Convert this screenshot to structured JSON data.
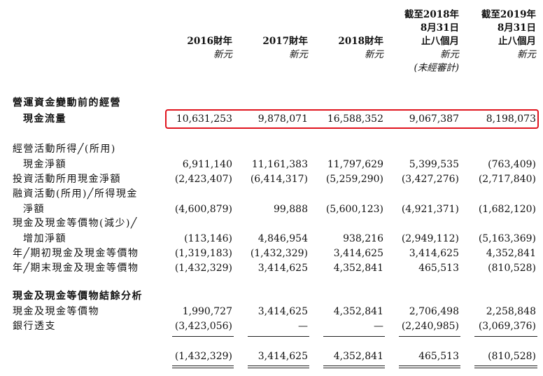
{
  "columns": [
    {
      "head": [
        "",
        "",
        "2016財年"
      ],
      "sub": [
        "新元"
      ]
    },
    {
      "head": [
        "",
        "",
        "2017財年"
      ],
      "sub": [
        "新元"
      ]
    },
    {
      "head": [
        "",
        "",
        "2018財年"
      ],
      "sub": [
        "新元"
      ]
    },
    {
      "head": [
        "截至2018年",
        "8月31日",
        "止八個月"
      ],
      "sub": [
        "新元",
        "(未經審計)"
      ]
    },
    {
      "head": [
        "截至2019年",
        "8月31日",
        "止八個月"
      ],
      "sub": [
        "新元"
      ]
    }
  ],
  "rows": [
    {
      "label": "營運資金變動前的經營",
      "bold": true,
      "values": [
        "",
        "",
        "",
        "",
        ""
      ]
    },
    {
      "label": "現金流量",
      "bold": true,
      "indent": true,
      "highlight": true,
      "values": [
        "10,631,253",
        "9,878,071",
        "16,588,352",
        "9,067,387",
        "8,198,073"
      ]
    },
    {
      "label": "經營活動所得╱(所用)",
      "values": [
        "",
        "",
        "",
        "",
        ""
      ]
    },
    {
      "label": "現金淨額",
      "indent": true,
      "values": [
        "6,911,140",
        "11,161,383",
        "11,797,629",
        "5,399,535",
        "(763,409)"
      ]
    },
    {
      "label": "投資活動所用現金淨額",
      "values": [
        "(2,423,407)",
        "(6,414,317)",
        "(5,259,290)",
        "(3,427,276)",
        "(2,717,840)"
      ]
    },
    {
      "label": "融資活動(所用)╱所得現金",
      "values": [
        "",
        "",
        "",
        "",
        ""
      ]
    },
    {
      "label": "淨額",
      "indent": true,
      "values": [
        "(4,600,879)",
        "99,888",
        "(5,600,123)",
        "(4,921,371)",
        "(1,682,120)"
      ]
    },
    {
      "label": "現金及現金等價物(減少)╱",
      "values": [
        "",
        "",
        "",
        "",
        ""
      ]
    },
    {
      "label": "增加淨額",
      "indent": true,
      "values": [
        "(113,146)",
        "4,846,954",
        "938,216",
        "(2,949,112)",
        "(5,163,369)"
      ]
    },
    {
      "label": "年╱期初現金及現金等價物",
      "values": [
        "(1,319,183)",
        "(1,432,329)",
        "3,414,625",
        "3,414,625",
        "4,352,841"
      ]
    },
    {
      "label": "年╱期末現金及現金等價物",
      "values": [
        "(1,432,329)",
        "3,414,625",
        "4,352,841",
        "465,513",
        "(810,528)"
      ]
    },
    {
      "label": "現金及現金等價物結餘分析",
      "bold": true,
      "values": [
        "",
        "",
        "",
        "",
        ""
      ]
    },
    {
      "label": "現金及現金等價物",
      "values": [
        "1,990,727",
        "3,414,625",
        "4,352,841",
        "2,706,498",
        "2,258,848"
      ]
    },
    {
      "label": "銀行透支",
      "values": [
        "(3,423,056)",
        "—",
        "—",
        "(2,240,985)",
        "(3,069,376)"
      ]
    },
    {
      "label": "",
      "total": true,
      "values": [
        "(1,432,329)",
        "3,414,625",
        "4,352,841",
        "465,513",
        "(810,528)"
      ]
    }
  ]
}
